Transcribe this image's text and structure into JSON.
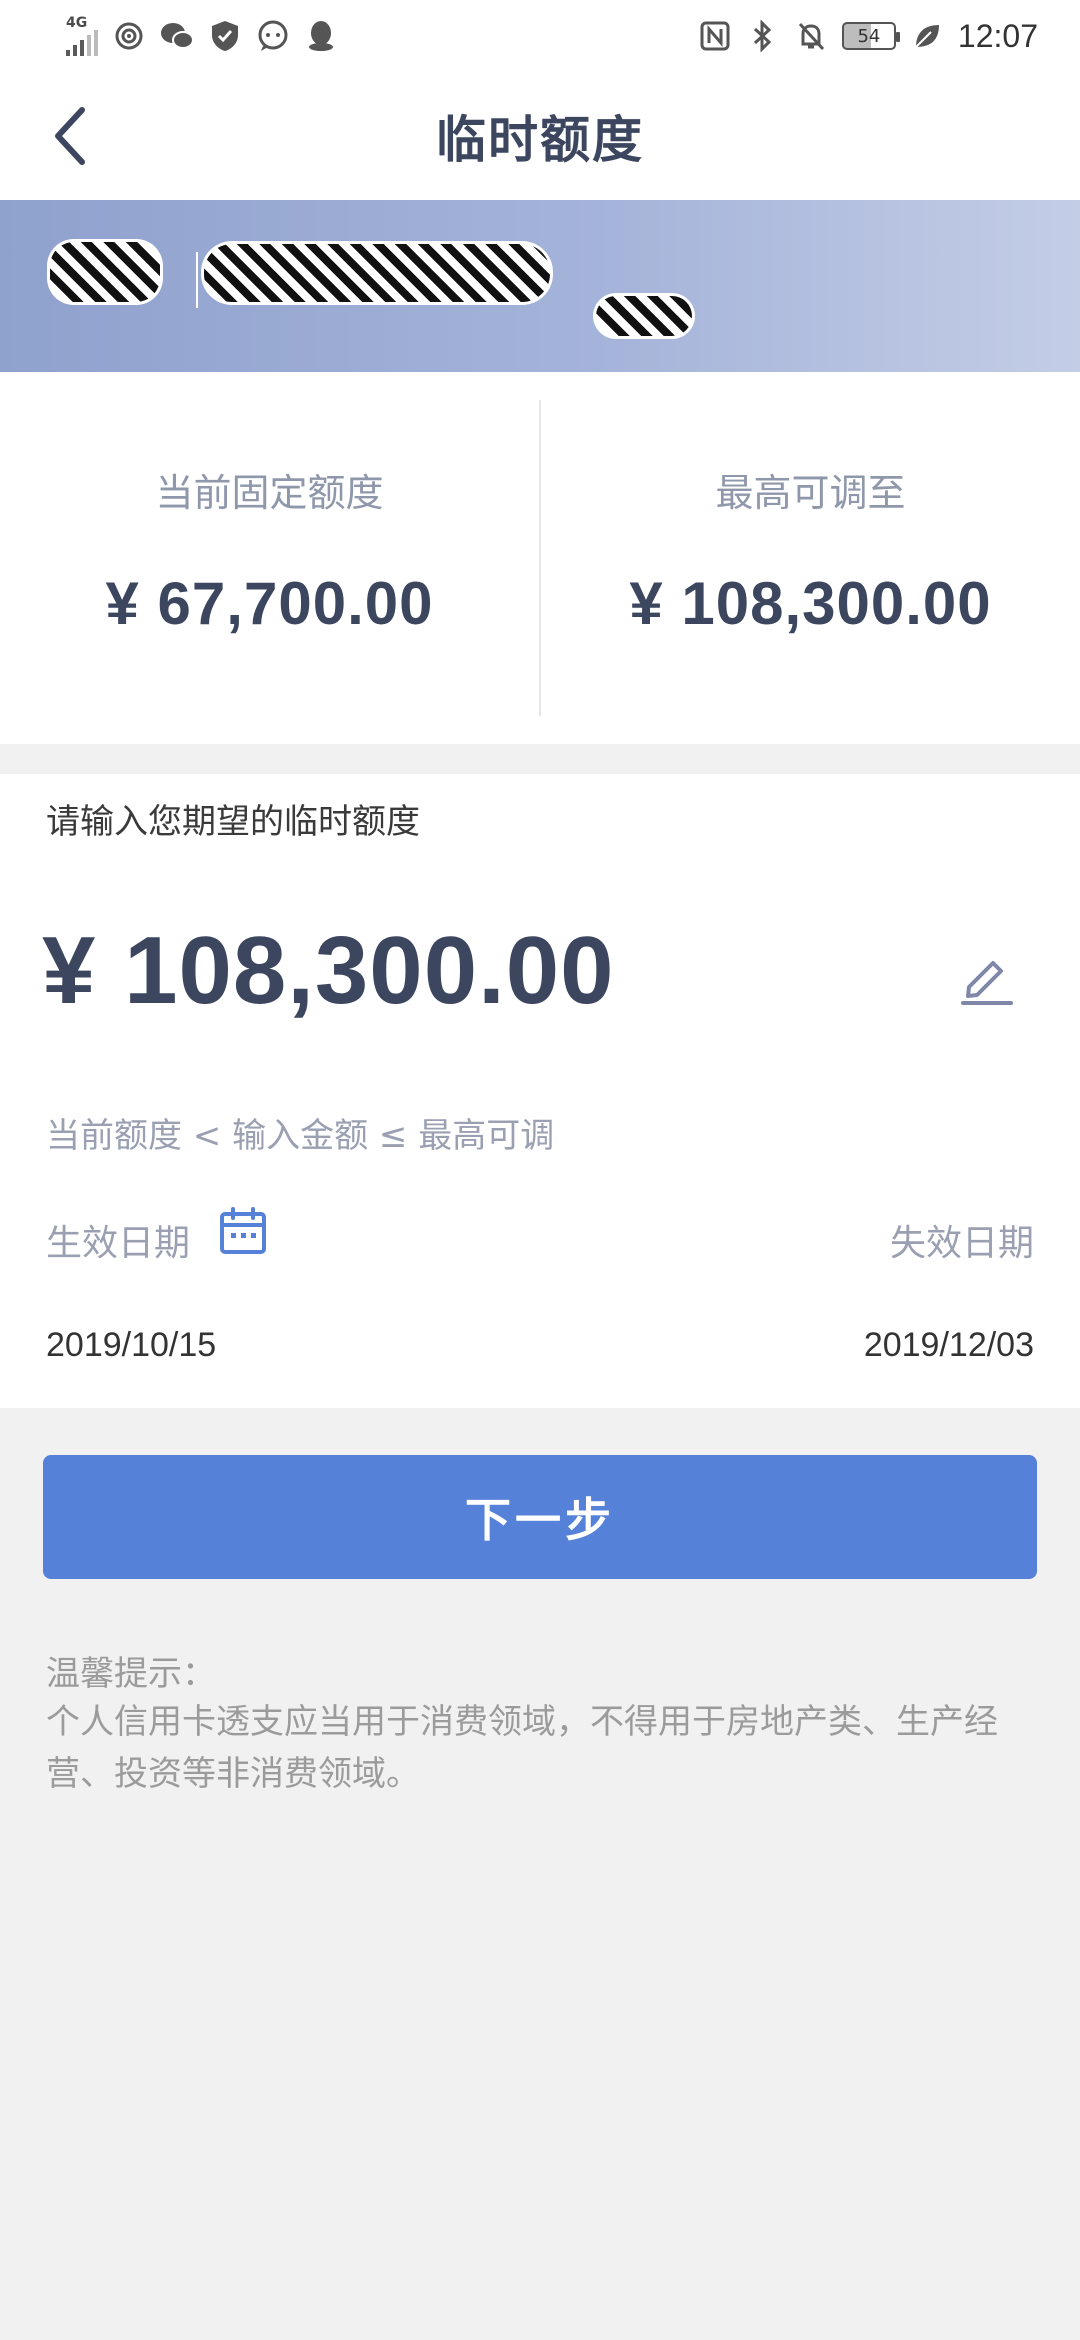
{
  "status_bar": {
    "network": "4G",
    "battery": "54",
    "time": "12:07"
  },
  "header": {
    "title": "临时额度"
  },
  "limits": {
    "current_label": "当前固定额度",
    "current_value": "¥ 67,700.00",
    "max_label": "最高可调至",
    "max_value": "¥ 108,300.00"
  },
  "input": {
    "hint": "请输入您期望的临时额度",
    "amount": "¥ 108,300.00",
    "range_hint": "当前额度 < 输入金额 ≤ 最高可调",
    "effective_label": "生效日期",
    "expiry_label": "失效日期",
    "effective_date": "2019/10/15",
    "expiry_date": "2019/12/03"
  },
  "next_button": {
    "label": "下一步"
  },
  "tips": {
    "title": "温馨提示：",
    "body": "个人信用卡透支应当用于消费领域，不得用于房地产类、生产经营、投资等非消费领域。"
  },
  "colors": {
    "primary": "#5581d8",
    "title_text": "#3c465f",
    "muted_text": "#9aa0b2",
    "banner_start": "#8fa1cd",
    "banner_end": "#c3cde6",
    "background": "#f1f1f1"
  },
  "icons": {
    "back": "chevron-left-icon",
    "edit": "pencil-icon",
    "calendar": "calendar-icon"
  }
}
